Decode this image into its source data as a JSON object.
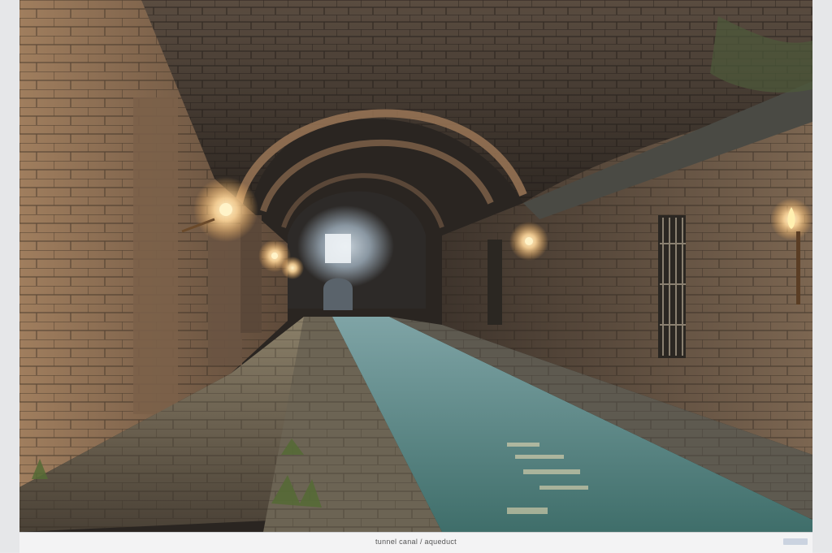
{
  "image": {
    "subject": "stone-vaulted-canal-tunnel",
    "caption": "tunnel canal / aqueduct"
  },
  "colors": {
    "stone_warm": "#8a6a4c",
    "stone_dark": "#3b3029",
    "water": "#4f7f79",
    "lamp_glow": "#ffd79a",
    "far_haze": "#a9b5bf"
  }
}
